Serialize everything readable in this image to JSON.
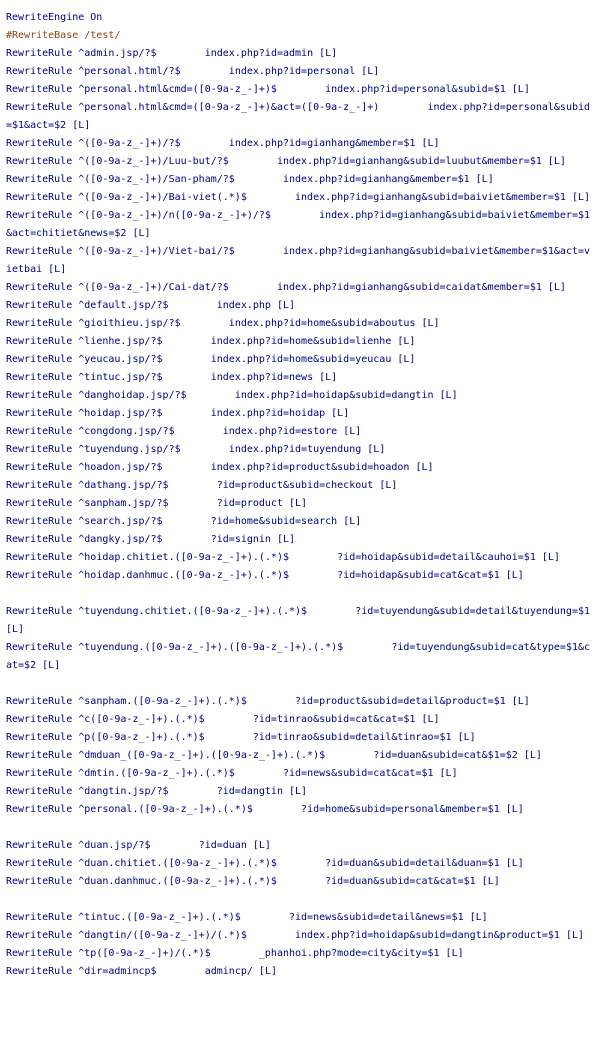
{
  "lines": [
    {
      "type": "plain",
      "text": "RewriteEngine On"
    },
    {
      "type": "comment",
      "text": "#RewriteBase /test/"
    },
    {
      "type": "rule",
      "kw": "RewriteRule",
      "pattern": "^admin.jsp/?$",
      "sub": "index.php?id=admin",
      "flags": "[L]"
    },
    {
      "type": "rule",
      "kw": "RewriteRule",
      "pattern": "^personal.html/?$",
      "sub": "index.php?id=personal",
      "flags": "[L]"
    },
    {
      "type": "rule",
      "kw": "RewriteRule",
      "pattern": "^personal.html&cmd=([0-9a-z_-]+)$",
      "sub": "index.php?id=personal&subid=$1",
      "flags": "[L]"
    },
    {
      "type": "rule",
      "kw": "RewriteRule",
      "pattern": "^personal.html&cmd=([0-9a-z_-]+)&act=([0-9a-z_-]+)",
      "sub": "index.php?id=personal&subid=$1&act=$2",
      "flags": "[L]"
    },
    {
      "type": "rule",
      "kw": "RewriteRule",
      "pattern": "^([0-9a-z_-]+)/?$",
      "sub": "index.php?id=gianhang&member=$1",
      "flags": "[L]"
    },
    {
      "type": "rule",
      "kw": "RewriteRule",
      "pattern": "^([0-9a-z_-]+)/Luu-but/?$",
      "sub": "index.php?id=gianhang&subid=luubut&member=$1",
      "flags": "[L]"
    },
    {
      "type": "rule",
      "kw": "RewriteRule",
      "pattern": "^([0-9a-z_-]+)/San-pham/?$",
      "sub": "index.php?id=gianhang&member=$1",
      "flags": "[L]"
    },
    {
      "type": "rule",
      "kw": "RewriteRule",
      "pattern": "^([0-9a-z_-]+)/Bai-viet(.*)$",
      "sub": "index.php?id=gianhang&subid=baiviet&member=$1",
      "flags": "[L]"
    },
    {
      "type": "rule",
      "kw": "RewriteRule",
      "pattern": "^([0-9a-z_-]+)/n([0-9a-z_-]+)/?$",
      "sub": "index.php?id=gianhang&subid=baiviet&member=$1&act=chitiet&news=$2",
      "flags": "[L]"
    },
    {
      "type": "rule",
      "kw": "RewriteRule",
      "pattern": "^([0-9a-z_-]+)/Viet-bai/?$",
      "sub": "index.php?id=gianhang&subid=baiviet&member=$1&act=vietbai",
      "flags": "[L]"
    },
    {
      "type": "rule",
      "kw": "RewriteRule",
      "pattern": "^([0-9a-z_-]+)/Cai-dat/?$",
      "sub": "index.php?id=gianhang&subid=caidat&member=$1",
      "flags": "[L]"
    },
    {
      "type": "rule",
      "kw": "RewriteRule",
      "pattern": "^default.jsp/?$",
      "sub": "index.php",
      "flags": "[L]"
    },
    {
      "type": "rule",
      "kw": "RewriteRule",
      "pattern": "^gioithieu.jsp/?$",
      "sub": "index.php?id=home&subid=aboutus",
      "flags": "[L]"
    },
    {
      "type": "rule",
      "kw": "RewriteRule",
      "pattern": "^lienhe.jsp/?$",
      "sub": "index.php?id=home&subid=lienhe",
      "flags": "[L]"
    },
    {
      "type": "rule",
      "kw": "RewriteRule",
      "pattern": "^yeucau.jsp/?$",
      "sub": "index.php?id=home&subid=yeucau",
      "flags": "[L]"
    },
    {
      "type": "rule",
      "kw": "RewriteRule",
      "pattern": "^tintuc.jsp/?$",
      "sub": "index.php?id=news",
      "flags": "[L]"
    },
    {
      "type": "rule",
      "kw": "RewriteRule",
      "pattern": "^danghoidap.jsp/?$",
      "sub": "index.php?id=hoidap&subid=dangtin",
      "flags": "[L]"
    },
    {
      "type": "rule",
      "kw": "RewriteRule",
      "pattern": "^hoidap.jsp/?$",
      "sub": "index.php?id=hoidap",
      "flags": "[L]"
    },
    {
      "type": "rule",
      "kw": "RewriteRule",
      "pattern": "^congdong.jsp/?$",
      "sub": "index.php?id=estore",
      "flags": "[L]"
    },
    {
      "type": "rule",
      "kw": "RewriteRule",
      "pattern": "^tuyendung.jsp/?$",
      "sub": "index.php?id=tuyendung",
      "flags": "[L]"
    },
    {
      "type": "rule",
      "kw": "RewriteRule",
      "pattern": "^hoadon.jsp/?$",
      "sub": "index.php?id=product&subid=hoadon",
      "flags": "[L]"
    },
    {
      "type": "rule",
      "kw": "RewriteRule",
      "pattern": "^dathang.jsp/?$",
      "sub": "?id=product&subid=checkout",
      "flags": "[L]"
    },
    {
      "type": "rule",
      "kw": "RewriteRule",
      "pattern": "^sanpham.jsp/?$",
      "sub": "?id=product",
      "flags": "[L]"
    },
    {
      "type": "rule",
      "kw": "RewriteRule",
      "pattern": "^search.jsp/?$",
      "sub": "?id=home&subid=search",
      "flags": "[L]"
    },
    {
      "type": "rule",
      "kw": "RewriteRule",
      "pattern": "^dangky.jsp/?$",
      "sub": "?id=signin",
      "flags": "[L]"
    },
    {
      "type": "rule",
      "kw": "RewriteRule",
      "pattern": "^hoidap.chitiet.([0-9a-z_-]+).(.*)$",
      "sub": "?id=hoidap&subid=detail&cauhoi=$1",
      "flags": "[L]"
    },
    {
      "type": "rule",
      "kw": "RewriteRule",
      "pattern": "^hoidap.danhmuc.([0-9a-z_-]+).(.*)$",
      "sub": "?id=hoidap&subid=cat&cat=$1",
      "flags": "[L]"
    },
    {
      "type": "blank"
    },
    {
      "type": "rule",
      "kw": "RewriteRule",
      "pattern": "^tuyendung.chitiet.([0-9a-z_-]+).(.*)$",
      "sub": "?id=tuyendung&subid=detail&tuyendung=$1",
      "flags": "[L]"
    },
    {
      "type": "rule",
      "kw": "RewriteRule",
      "pattern": "^tuyendung.([0-9a-z_-]+).([0-9a-z_-]+).(.*)$",
      "sub": "?id=tuyendung&subid=cat&type=$1&cat=$2",
      "flags": "[L]"
    },
    {
      "type": "blank"
    },
    {
      "type": "rule",
      "kw": "RewriteRule",
      "pattern": "^sanpham.([0-9a-z_-]+).(.*)$",
      "sub": "?id=product&subid=detail&product=$1",
      "flags": "[L]"
    },
    {
      "type": "rule",
      "kw": "RewriteRule",
      "pattern": "^c([0-9a-z_-]+).(.*)$",
      "sub": "?id=tinrao&subid=cat&cat=$1",
      "flags": "[L]"
    },
    {
      "type": "rule",
      "kw": "RewriteRule",
      "pattern": "^p([0-9a-z_-]+).(.*)$",
      "sub": "?id=tinrao&subid=detail&tinrao=$1",
      "flags": "[L]"
    },
    {
      "type": "rule",
      "kw": "RewriteRule",
      "pattern": "^dmduan_([0-9a-z_-]+).([0-9a-z_-]+).(.*)$",
      "sub": "?id=duan&subid=cat&$1=$2",
      "flags": "[L]"
    },
    {
      "type": "rule",
      "kw": "RewriteRule",
      "pattern": "^dmtin.([0-9a-z_-]+).(.*)$",
      "sub": "?id=news&subid=cat&cat=$1",
      "flags": "[L]"
    },
    {
      "type": "rule",
      "kw": "RewriteRule",
      "pattern": "^dangtin.jsp/?$",
      "sub": "?id=dangtin",
      "flags": "[L]"
    },
    {
      "type": "rule",
      "kw": "RewriteRule",
      "pattern": "^personal.([0-9a-z_-]+).(.*)$",
      "sub": "?id=home&subid=personal&member=$1",
      "flags": "[L]"
    },
    {
      "type": "blank"
    },
    {
      "type": "rule",
      "kw": "RewriteRule",
      "pattern": "^duan.jsp/?$",
      "sub": "?id=duan",
      "flags": "[L]"
    },
    {
      "type": "rule",
      "kw": "RewriteRule",
      "pattern": "^duan.chitiet.([0-9a-z_-]+).(.*)$",
      "sub": "?id=duan&subid=detail&duan=$1",
      "flags": "[L]"
    },
    {
      "type": "rule",
      "kw": "RewriteRule",
      "pattern": "^duan.danhmuc.([0-9a-z_-]+).(.*)$",
      "sub": "?id=duan&subid=cat&cat=$1",
      "flags": "[L]"
    },
    {
      "type": "blank"
    },
    {
      "type": "rule",
      "kw": "RewriteRule",
      "pattern": "^tintuc.([0-9a-z_-]+).(.*)$",
      "sub": "?id=news&subid=detail&news=$1",
      "flags": "[L]"
    },
    {
      "type": "rule",
      "kw": "RewriteRule",
      "pattern": "^dangtin/([0-9a-z_-]+)/(.*)$",
      "sub": "index.php?id=hoidap&subid=dangtin&product=$1",
      "flags": "[L]"
    },
    {
      "type": "rule",
      "kw": "RewriteRule",
      "pattern": "^tp([0-9a-z_-]+)/(.*)$",
      "sub": "_phanhoi.php?mode=city&city=$1",
      "flags": "[L]"
    },
    {
      "type": "rule",
      "kw": "RewriteRule",
      "pattern": "^dir=admincp$",
      "sub": "admincp/",
      "flags": "[L]"
    }
  ]
}
